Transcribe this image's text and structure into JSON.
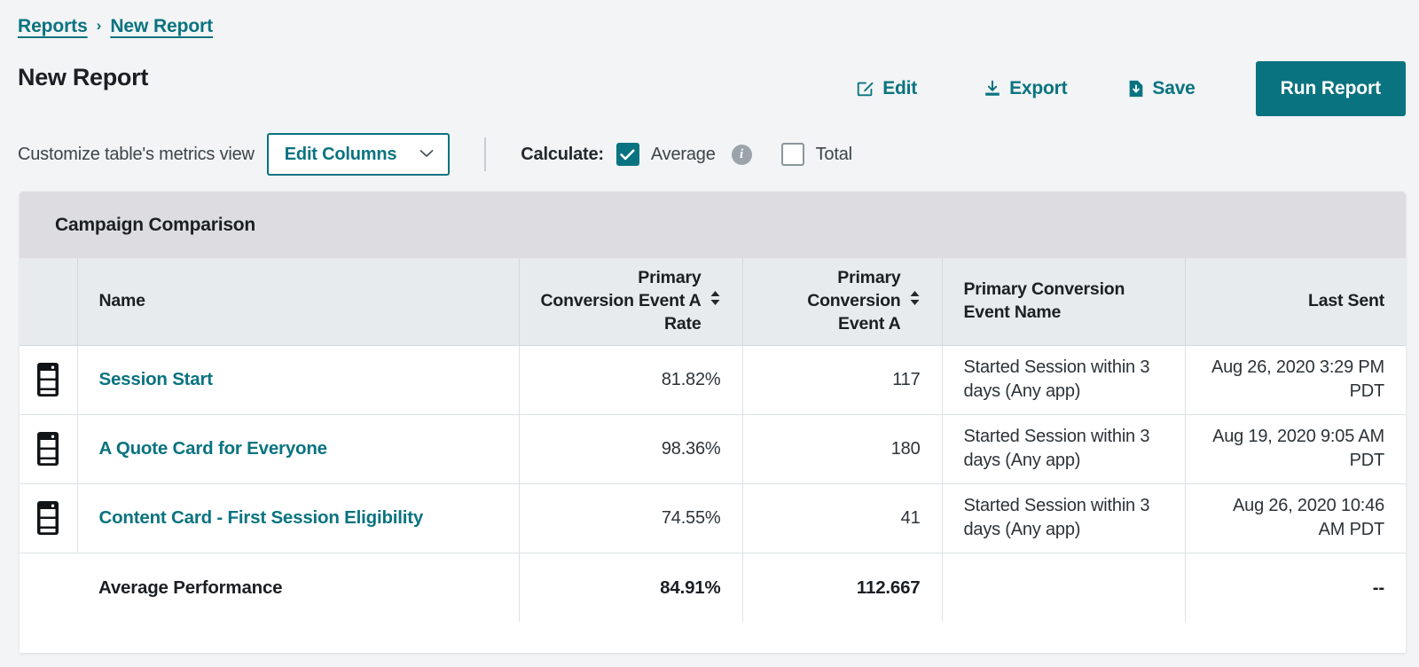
{
  "colors": {
    "teal": "#0a7380",
    "page_bg": "#f2f4f5",
    "card_header_bg": "#dcdce1",
    "table_header_bg": "#e7ebed",
    "info_gray": "#9aa4aa"
  },
  "breadcrumb": {
    "items": [
      {
        "label": "Reports"
      },
      {
        "label": "New Report"
      }
    ],
    "separator": "›"
  },
  "header": {
    "title": "New Report",
    "actions": [
      {
        "id": "edit",
        "label": "Edit",
        "icon": "edit-pencil-icon"
      },
      {
        "id": "export",
        "label": "Export",
        "icon": "download-icon"
      },
      {
        "id": "save",
        "label": "Save",
        "icon": "save-file-icon"
      }
    ],
    "run_button": {
      "label": "Run Report"
    }
  },
  "controls": {
    "customize_label": "Customize table's metrics view",
    "edit_columns": {
      "label": "Edit Columns",
      "chevron_icon": "chevron-down-icon"
    },
    "calculate_label": "Calculate:",
    "options": [
      {
        "id": "average",
        "label": "Average",
        "checked": true,
        "info_icon": "info-circle-icon",
        "info_glyph": "i"
      },
      {
        "id": "total",
        "label": "Total",
        "checked": false
      }
    ]
  },
  "card": {
    "title": "Campaign Comparison"
  },
  "table": {
    "columns": [
      {
        "id": "icon",
        "label": "",
        "align": "left",
        "sortable": false
      },
      {
        "id": "name",
        "label": "Name",
        "align": "left",
        "sortable": false
      },
      {
        "id": "rate",
        "label": "Primary Conversion Event A Rate",
        "align": "right",
        "sortable": true
      },
      {
        "id": "count",
        "label": "Primary Conversion Event A",
        "align": "right",
        "sortable": true
      },
      {
        "id": "event",
        "label": "Primary Conversion Event Name",
        "align": "left",
        "sortable": false
      },
      {
        "id": "sent",
        "label": "Last Sent",
        "align": "right",
        "sortable": false
      }
    ],
    "rows": [
      {
        "icon": "content-card-icon",
        "name": "Session Start",
        "rate": "81.82%",
        "count": "117",
        "event": "Started Session within 3 days (Any app)",
        "sent": "Aug 26, 2020 3:29 PM PDT"
      },
      {
        "icon": "content-card-icon",
        "name": "A Quote Card for Everyone",
        "rate": "98.36%",
        "count": "180",
        "event": "Started Session within 3 days (Any app)",
        "sent": "Aug 19, 2020 9:05 AM PDT"
      },
      {
        "icon": "content-card-icon",
        "name": "Content Card - First Session Eligibility",
        "rate": "74.55%",
        "count": "41",
        "event": "Started Session within 3 days (Any app)",
        "sent": "Aug 26, 2020 10:46 AM PDT"
      }
    ],
    "footer": {
      "label": "Average Performance",
      "rate": "84.91%",
      "count": "112.667",
      "event": "",
      "sent": "--"
    }
  }
}
